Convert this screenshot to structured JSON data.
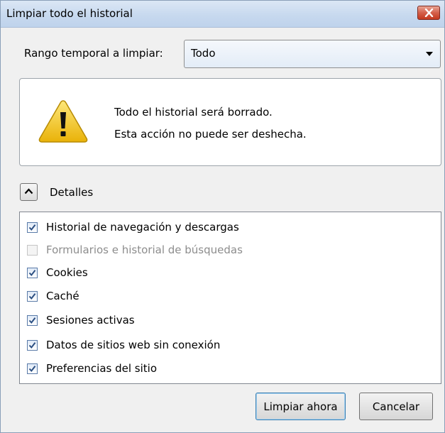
{
  "window": {
    "title": "Limpiar todo el historial"
  },
  "range": {
    "label": "Rango temporal a limpiar:",
    "selected": "Todo"
  },
  "warning": {
    "line1": "Todo el historial será borrado.",
    "line2": "Esta acción no puede ser deshecha."
  },
  "details": {
    "label": "Detalles",
    "items": [
      {
        "label": "Historial de navegación y descargas",
        "checked": true,
        "enabled": true
      },
      {
        "label": "Formularios e historial de búsquedas",
        "checked": false,
        "enabled": false
      },
      {
        "label": "Cookies",
        "checked": true,
        "enabled": true
      },
      {
        "label": "Caché",
        "checked": true,
        "enabled": true
      },
      {
        "label": "Sesiones activas",
        "checked": true,
        "enabled": true
      },
      {
        "label": "Datos de sitios web sin conexión",
        "checked": true,
        "enabled": true
      },
      {
        "label": "Preferencias del sitio",
        "checked": true,
        "enabled": true
      }
    ]
  },
  "buttons": {
    "clear_now": "Limpiar ahora",
    "cancel": "Cancelar"
  },
  "icons": {
    "close": "close-icon",
    "dropdown": "chevron-down-icon",
    "warning": "warning-icon",
    "collapse": "chevron-up-icon",
    "check": "checkmark-icon"
  },
  "colors": {
    "close_button": "#c4391f",
    "warning_yellow": "#f2c511",
    "disabled_text": "#8d8d8d"
  }
}
